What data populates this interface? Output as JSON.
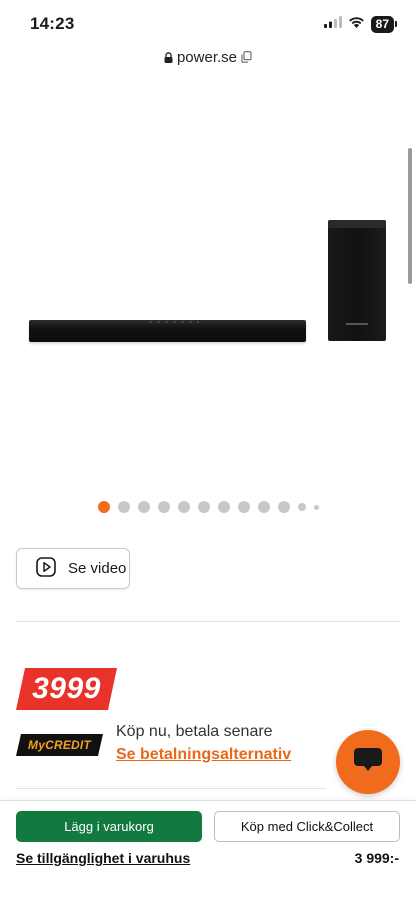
{
  "status_bar": {
    "time": "14:23",
    "battery": "87",
    "icons": [
      "signal-icon",
      "wifi-icon",
      "battery-icon"
    ]
  },
  "browser": {
    "url": "power.se"
  },
  "gallery": {
    "image_count": 12,
    "active_index": 0
  },
  "video_button": {
    "label": "Se video",
    "icon": "play-icon"
  },
  "price": {
    "value": "3999"
  },
  "credit": {
    "logo_text": "MyCREDIT",
    "title": "Köp nu, betala senare",
    "link": "Se betalningsalternativ"
  },
  "chat": {
    "icon": "chat-bubble-icon"
  },
  "bottom_bar": {
    "add_to_cart": "Lägg i varukorg",
    "click_collect": "Köp med Click&Collect",
    "store_availability": "Se tillgänglighet i varuhus",
    "price": "3 999:-"
  },
  "colors": {
    "accent_orange": "#f26b1d",
    "price_red": "#e8322a",
    "cta_green": "#137a3f"
  }
}
